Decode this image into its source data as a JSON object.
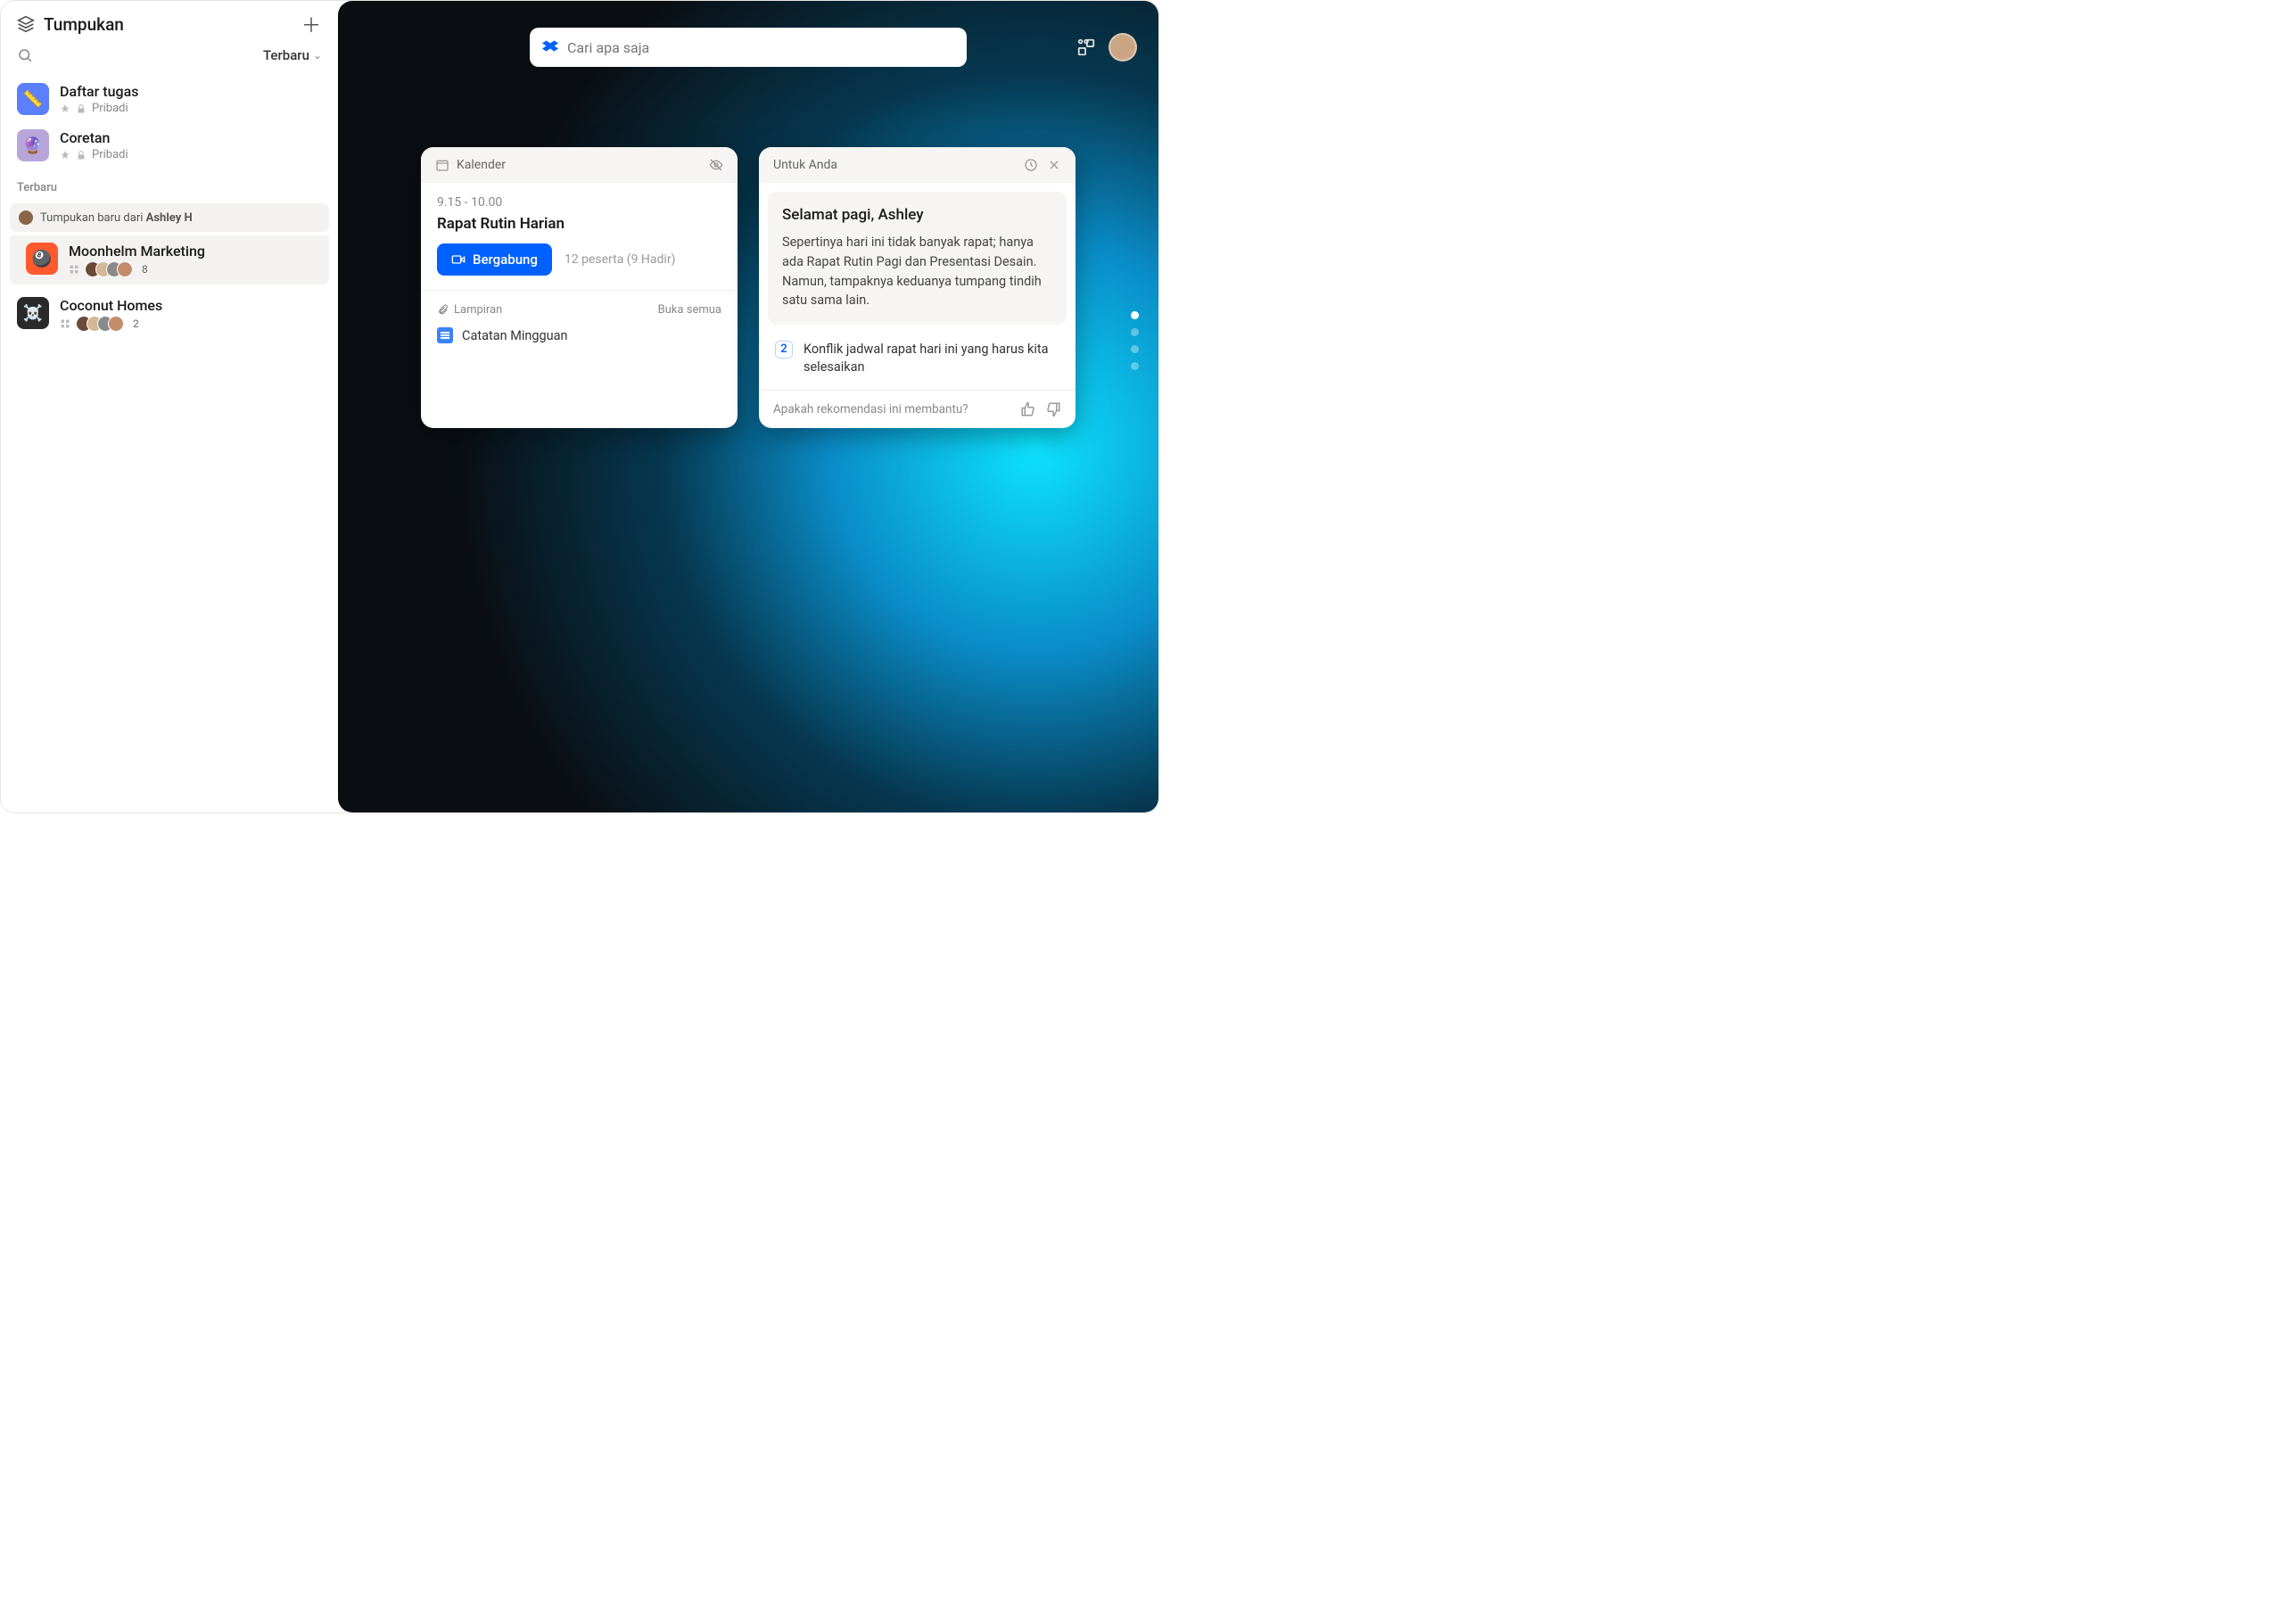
{
  "sidebar": {
    "title": "Tumpukan",
    "sort_label": "Terbaru",
    "pinned": [
      {
        "icon": "📏",
        "title": "Daftar tugas",
        "privacy": "Pribadi"
      },
      {
        "icon": "🔮",
        "title": "Coretan",
        "privacy": "Pribadi"
      }
    ],
    "section_label": "Terbaru",
    "banner_prefix": "Tumpukan baru dari ",
    "banner_author": "Ashley H",
    "recent": [
      {
        "icon": "🎱",
        "title": "Moonhelm Marketing",
        "members": 8
      },
      {
        "icon": "☠️",
        "title": "Coconut Homes",
        "members": 2
      }
    ]
  },
  "search": {
    "placeholder": "Cari apa saja"
  },
  "calendar_card": {
    "title": "Kalender",
    "time": "9.15 - 10.00",
    "event_title": "Rapat Rutin Harian",
    "join_label": "Bergabung",
    "attendees": "12 peserta (9 Hadir)",
    "attach_label": "Lampiran",
    "open_all": "Buka semua",
    "attachment": "Catatan Mingguan"
  },
  "foryou_card": {
    "title": "Untuk Anda",
    "greeting": "Selamat pagi, Ashley",
    "summary": "Sepertinya hari ini tidak banyak rapat; hanya ada Rapat Rutin Pagi dan Presentasi Desain. Namun, tampaknya keduanya tumpang tindih satu sama lain.",
    "badge": "2",
    "item": "Konflik jadwal rapat hari ini yang harus kita selesaikan",
    "feedback_q": "Apakah rekomendasi ini membantu?"
  }
}
